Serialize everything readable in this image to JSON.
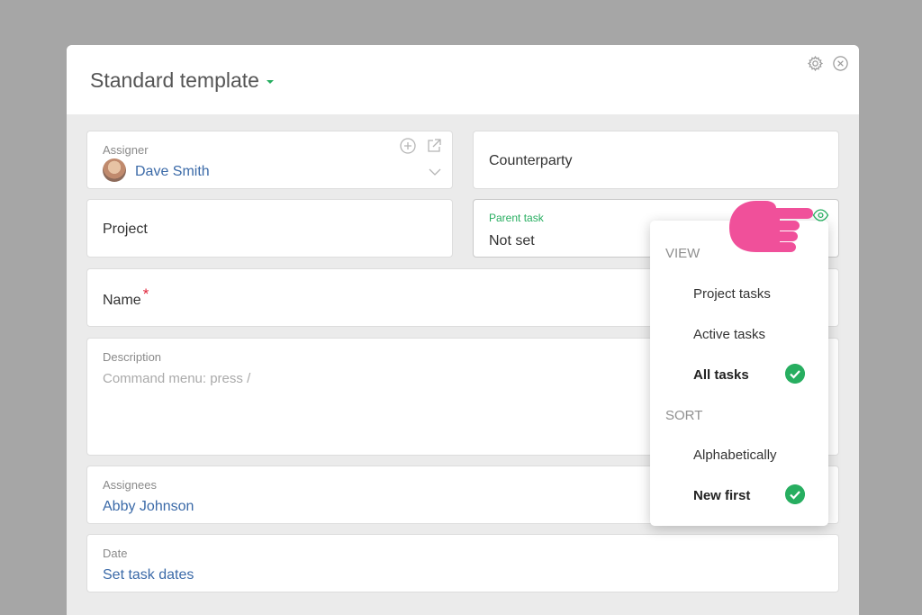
{
  "modal": {
    "title": "Standard template"
  },
  "fields": {
    "assigner": {
      "label": "Assigner",
      "value": "Dave Smith"
    },
    "counterparty": {
      "label": "Counterparty"
    },
    "project": {
      "label": "Project"
    },
    "parent_task": {
      "label": "Parent task",
      "value": "Not set"
    },
    "name": {
      "label": "Name",
      "required_mark": "*"
    },
    "description": {
      "label": "Description",
      "placeholder": "Command menu: press /"
    },
    "assignees": {
      "label": "Assignees",
      "value": "Abby Johnson"
    },
    "date": {
      "label": "Date",
      "value": "Set task dates"
    }
  },
  "dropdown": {
    "view_heading": "VIEW",
    "view_options": [
      "Project tasks",
      "Active tasks",
      "All tasks"
    ],
    "view_selected": "All tasks",
    "sort_heading": "SORT",
    "sort_options": [
      "Alphabetically",
      "New first"
    ],
    "sort_selected": "New first"
  },
  "colors": {
    "accent": "#27ae60",
    "link": "#3b6aa8",
    "required": "#e0243a",
    "pointer_hand": "#f0509a"
  },
  "icons": [
    "chevron-down-icon",
    "gear-icon",
    "close-icon",
    "add-circle-icon",
    "open-external-icon",
    "eye-icon",
    "checkmark-icon",
    "pointing-hand-icon"
  ]
}
